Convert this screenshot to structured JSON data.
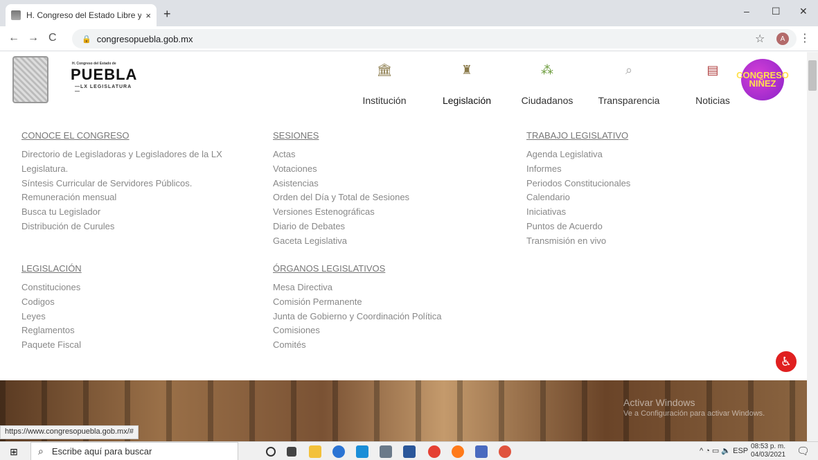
{
  "browser": {
    "tab_title": "H. Congreso del Estado Libre y S",
    "new_tab": "+",
    "close_tab": "×",
    "url": "congresopuebla.gob.mx",
    "avatar_letter": "A",
    "min": "–",
    "max": "☐",
    "close": "✕"
  },
  "site": {
    "logo_small": "H. Congreso del Estado de",
    "logo_name": "PUEBLA",
    "logo_sub": "—LX LEGISLATURA—",
    "nav": [
      {
        "label": "Institución",
        "icon": "building-icon"
      },
      {
        "label": "Legislación",
        "icon": "statue-icon"
      },
      {
        "label": "Ciudadanos",
        "icon": "people-icon"
      },
      {
        "label": "Transparencia",
        "icon": "magnifier-icon"
      },
      {
        "label": "Noticias",
        "icon": "newspaper-icon"
      }
    ],
    "badge": "CONGRESO NIÑEZ"
  },
  "menu": {
    "conoce": {
      "heading": "CONOCE EL CONGRESO",
      "links": [
        "Directorio de Legisladoras y Legisladores de la LX",
        "Legislatura.",
        "Síntesis Curricular de Servidores Públicos.",
        "Remuneración mensual",
        "Busca tu Legislador",
        "Distribución de Curules"
      ]
    },
    "sesiones": {
      "heading": "SESIONES",
      "links": [
        "Actas",
        "Votaciones",
        "Asistencias",
        "Orden del Día y Total de Sesiones",
        "Versiones Estenográficas",
        "Diario de Debates",
        "Gaceta Legislativa"
      ]
    },
    "trabajo": {
      "heading": "TRABAJO LEGISLATIVO",
      "links": [
        "Agenda Legislativa",
        "Informes",
        "Periodos Constitucionales",
        "Calendario",
        "Iniciativas",
        "Puntos de Acuerdo",
        "Transmisión en vivo"
      ]
    },
    "legislacion": {
      "heading": "LEGISLACIÓN",
      "links": [
        "Constituciones",
        "Codigos",
        "Leyes",
        "Reglamentos",
        "Paquete Fiscal"
      ]
    },
    "organos": {
      "heading": "ÓRGANOS LEGISLATIVOS",
      "links": [
        "Mesa Directiva",
        "Comisión Permanente",
        "Junta de Gobierno y Coordinación Política",
        "Comisiones",
        "Comités"
      ]
    }
  },
  "overlay": {
    "activate_title": "Activar Windows",
    "activate_sub": "Ve a Configuración para activar Windows.",
    "status_url": "https://www.congresopuebla.gob.mx/#"
  },
  "taskbar": {
    "search_placeholder": "Escribe aquí para buscar",
    "lang": "ESP",
    "time": "08:53 p. m.",
    "date": "04/03/2021"
  }
}
